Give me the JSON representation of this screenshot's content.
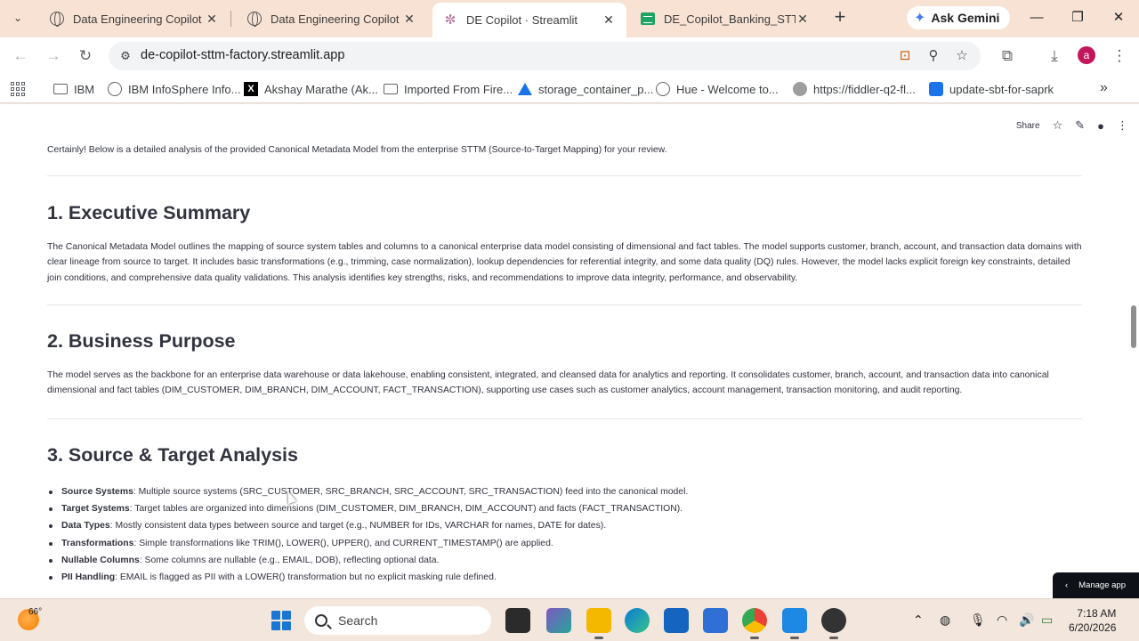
{
  "browser": {
    "tabs": [
      {
        "title": "Data Engineering Copilot — ",
        "favicon": "globe-icon",
        "active": false
      },
      {
        "title": "Data Engineering Copilot — ",
        "favicon": "globe-icon",
        "active": false
      },
      {
        "title": "DE Copilot · Streamlit",
        "favicon": "streamlit-icon",
        "active": true
      },
      {
        "title": "DE_Copilot_Banking_STTM_",
        "favicon": "sheets-icon",
        "active": false
      }
    ],
    "gemini_label": "Ask Gemini",
    "url": "de-copilot-sttm-factory.streamlit.app",
    "profile_initial": "a",
    "bookmarks": [
      {
        "label": "IBM",
        "icon": "folder-icon"
      },
      {
        "label": "IBM InfoSphere Info...",
        "icon": "globe-icon"
      },
      {
        "label": "Akshay Marathe (Ak...",
        "icon": "x-icon"
      },
      {
        "label": "Imported From Fire...",
        "icon": "folder-icon"
      },
      {
        "label": "storage_container_p...",
        "icon": "azure-icon"
      },
      {
        "label": "Hue - Welcome to...",
        "icon": "globe-icon"
      },
      {
        "label": "https://fiddler-q2-fl...",
        "icon": "fiddler-icon"
      },
      {
        "label": "update-sbt-for-saprk",
        "icon": "doc-icon"
      }
    ]
  },
  "app_header": {
    "share_label": "Share"
  },
  "report": {
    "intro": "Certainly! Below is a detailed analysis of the provided Canonical Metadata Model from the enterprise STTM (Source-to-Target Mapping) for your review.",
    "sections": [
      {
        "title": "1. Executive Summary",
        "body": "The Canonical Metadata Model outlines the mapping of source system tables and columns to a canonical enterprise data model consisting of dimensional and fact tables. The model supports customer, branch, account, and transaction data domains with clear lineage from source to target. It includes basic transformations (e.g., trimming, case normalization), lookup dependencies for referential integrity, and some data quality (DQ) rules. However, the model lacks explicit foreign key constraints, detailed join conditions, and comprehensive data quality validations. This analysis identifies key strengths, risks, and recommendations to improve data integrity, performance, and observability."
      },
      {
        "title": "2. Business Purpose",
        "body": "The model serves as the backbone for an enterprise data warehouse or data lakehouse, enabling consistent, integrated, and cleansed data for analytics and reporting. It consolidates customer, branch, account, and transaction data into canonical dimensional and fact tables (DIM_CUSTOMER, DIM_BRANCH, DIM_ACCOUNT, FACT_TRANSACTION), supporting use cases such as customer analytics, account management, transaction monitoring, and audit reporting."
      },
      {
        "title": "3. Source & Target Analysis",
        "bullets": [
          {
            "term": "Source Systems",
            "text": ": Multiple source systems (SRC_CUSTOMER, SRC_BRANCH, SRC_ACCOUNT, SRC_TRANSACTION) feed into the canonical model."
          },
          {
            "term": "Target Systems",
            "text": ": Target tables are organized into dimensions (DIM_CUSTOMER, DIM_BRANCH, DIM_ACCOUNT) and facts (FACT_TRANSACTION)."
          },
          {
            "term": "Data Types",
            "text": ": Mostly consistent data types between source and target (e.g., NUMBER for IDs, VARCHAR for names, DATE for dates)."
          },
          {
            "term": "Transformations",
            "text": ": Simple transformations like TRIM(), LOWER(), UPPER(), and CURRENT_TIMESTAMP() are applied."
          },
          {
            "term": "Nullable Columns",
            "text": ": Some columns are nullable (e.g., EMAIL, DOB), reflecting optional data."
          },
          {
            "term": "PII Handling",
            "text": ": EMAIL is flagged as PII with a LOWER() transformation but no explicit masking rule defined."
          }
        ]
      }
    ]
  },
  "manage_app_label": "Manage app",
  "taskbar": {
    "temperature": "66°",
    "search_label": "Search",
    "time": "7:18 AM",
    "date": "6/20/2026"
  },
  "colors": {
    "chrome_frame": "#f8e2d3",
    "text": "#31333f",
    "manage_bg": "#0e1117",
    "taskbar": "#f3e6dc"
  }
}
